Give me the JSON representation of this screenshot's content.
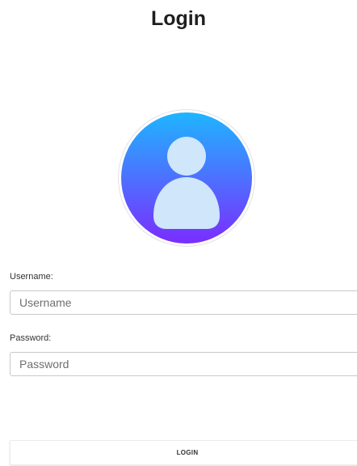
{
  "page": {
    "title": "Login"
  },
  "avatar": {
    "icon": "user-avatar-icon",
    "gradient_top": "#1fb5ff",
    "gradient_bottom": "#7a2dff",
    "figure_color": "#cfe6fb"
  },
  "form": {
    "username_label": "Username:",
    "username_placeholder": "Username",
    "username_value": "",
    "password_label": "Password:",
    "password_placeholder": "Password",
    "password_value": ""
  },
  "actions": {
    "login_label": "LOGIN"
  }
}
